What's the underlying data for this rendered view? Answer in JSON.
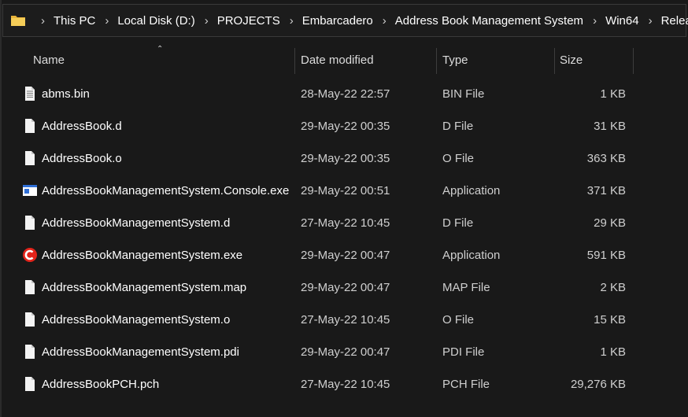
{
  "breadcrumb": [
    "This PC",
    "Local Disk (D:)",
    "PROJECTS",
    "Embarcadero",
    "Address Book Management System",
    "Win64",
    "Release"
  ],
  "columns": {
    "name": "Name",
    "date": "Date modified",
    "type": "Type",
    "size": "Size"
  },
  "files": [
    {
      "name": "abms.bin",
      "date": "28-May-22 22:57",
      "type": "BIN File",
      "size": "1 KB",
      "icon": "text-file-icon"
    },
    {
      "name": "AddressBook.d",
      "date": "29-May-22 00:35",
      "type": "D File",
      "size": "31 KB",
      "icon": "blank-file-icon"
    },
    {
      "name": "AddressBook.o",
      "date": "29-May-22 00:35",
      "type": "O File",
      "size": "363 KB",
      "icon": "blank-file-icon"
    },
    {
      "name": "AddressBookManagementSystem.Console.exe",
      "date": "29-May-22 00:51",
      "type": "Application",
      "size": "371 KB",
      "icon": "console-app-icon"
    },
    {
      "name": "AddressBookManagementSystem.d",
      "date": "27-May-22 10:45",
      "type": "D File",
      "size": "29 KB",
      "icon": "blank-file-icon"
    },
    {
      "name": "AddressBookManagementSystem.exe",
      "date": "29-May-22 00:47",
      "type": "Application",
      "size": "591 KB",
      "icon": "cbuilder-app-icon"
    },
    {
      "name": "AddressBookManagementSystem.map",
      "date": "29-May-22 00:47",
      "type": "MAP File",
      "size": "2 KB",
      "icon": "blank-file-icon"
    },
    {
      "name": "AddressBookManagementSystem.o",
      "date": "27-May-22 10:45",
      "type": "O File",
      "size": "15 KB",
      "icon": "blank-file-icon"
    },
    {
      "name": "AddressBookManagementSystem.pdi",
      "date": "29-May-22 00:47",
      "type": "PDI File",
      "size": "1 KB",
      "icon": "blank-file-icon"
    },
    {
      "name": "AddressBookPCH.pch",
      "date": "27-May-22 10:45",
      "type": "PCH File",
      "size": "29,276 KB",
      "icon": "blank-file-icon"
    }
  ],
  "colors": {
    "background": "#191919",
    "folder": "#f0c24b",
    "cbuilder_red": "#e2231a"
  }
}
